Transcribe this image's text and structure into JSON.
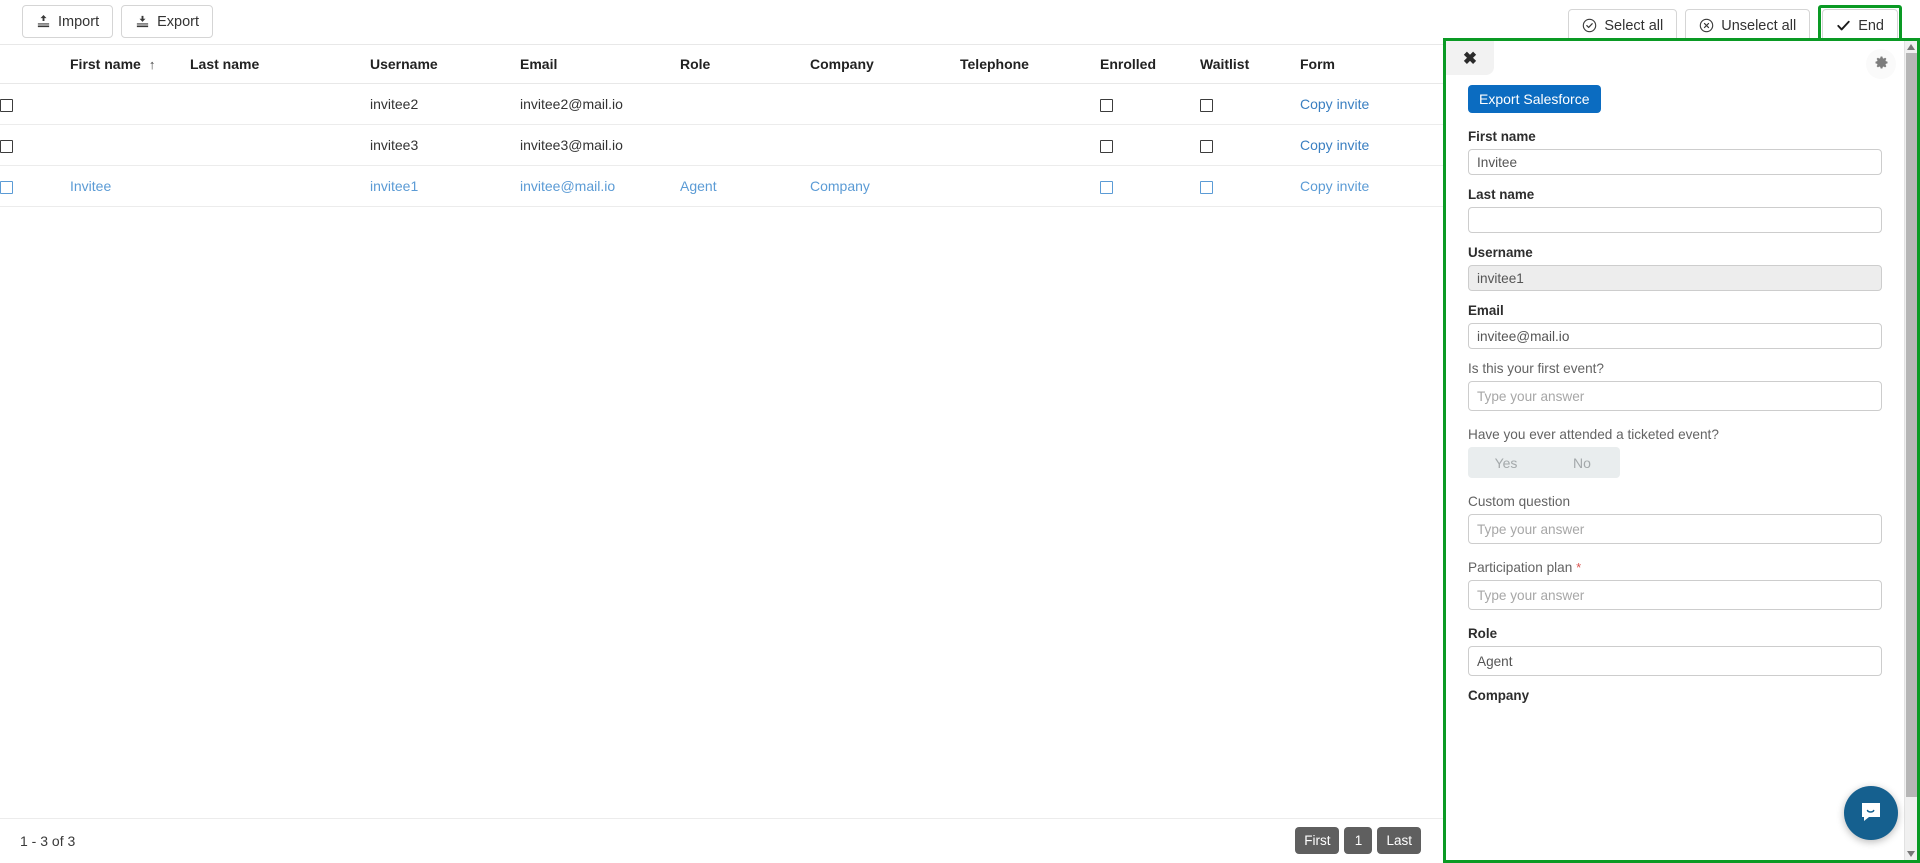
{
  "toolbar": {
    "import_label": "Import",
    "export_label": "Export",
    "select_all_label": "Select all",
    "unselect_all_label": "Unselect all",
    "end_label": "End"
  },
  "table": {
    "columns": [
      "",
      "First name",
      "Last name",
      "Username",
      "Email",
      "Role",
      "Company",
      "Telephone",
      "Enrolled",
      "Waitlist",
      "Form"
    ],
    "sort_column": "First name",
    "sort_direction": "↑",
    "rows": [
      {
        "first_name": "",
        "last_name": "",
        "username": "invitee2",
        "email": "invitee2@mail.io",
        "role": "",
        "company": "",
        "telephone": "",
        "form_link": "Copy invite",
        "selected": false
      },
      {
        "first_name": "",
        "last_name": "",
        "username": "invitee3",
        "email": "invitee3@mail.io",
        "role": "",
        "company": "",
        "telephone": "",
        "form_link": "Copy invite",
        "selected": false
      },
      {
        "first_name": "Invitee",
        "last_name": "",
        "username": "invitee1",
        "email": "invitee@mail.io",
        "role": "Agent",
        "company": "Company",
        "telephone": "",
        "form_link": "Copy invite",
        "selected": true
      }
    ]
  },
  "footer": {
    "count_label": "1 - 3 of 3",
    "pager": {
      "first_label": "First",
      "page_label": "1",
      "last_label": "Last"
    }
  },
  "panel": {
    "close_label": "✖",
    "export_salesforce_label": "Export Salesforce",
    "fields": [
      {
        "label": "First name",
        "value": "Invitee",
        "placeholder": "",
        "type": "text",
        "bold": true,
        "disabled": false,
        "required": false
      },
      {
        "label": "Last name",
        "value": "",
        "placeholder": "",
        "type": "text",
        "bold": true,
        "disabled": false,
        "required": false
      },
      {
        "label": "Username",
        "value": "invitee1",
        "placeholder": "",
        "type": "text",
        "bold": true,
        "disabled": true,
        "required": false
      },
      {
        "label": "Email",
        "value": "invitee@mail.io",
        "placeholder": "",
        "type": "text",
        "bold": true,
        "disabled": false,
        "required": false
      },
      {
        "label": "Is this your first event?",
        "value": "",
        "placeholder": "Type your answer",
        "type": "text",
        "bold": false,
        "disabled": false,
        "required": false
      },
      {
        "label": "Have you ever attended a ticketed event?",
        "value": "",
        "placeholder": "",
        "type": "yesno",
        "bold": false,
        "disabled": false,
        "required": false
      },
      {
        "label": "Custom question",
        "value": "",
        "placeholder": "Type your answer",
        "type": "text",
        "bold": false,
        "disabled": false,
        "required": false
      },
      {
        "label": "Participation plan",
        "value": "",
        "placeholder": "Type your answer",
        "type": "text",
        "bold": false,
        "disabled": false,
        "required": true
      },
      {
        "label": "Role",
        "value": "Agent",
        "placeholder": "",
        "type": "text",
        "bold": true,
        "disabled": false,
        "required": false
      },
      {
        "label": "Company",
        "value": "",
        "placeholder": "",
        "type": "cutoff",
        "bold": true,
        "disabled": false,
        "required": false
      }
    ],
    "yes_label": "Yes",
    "no_label": "No",
    "required_marker": "*"
  },
  "colors": {
    "accent_blue": "#0b6cc1",
    "link_blue": "#3a7fc1",
    "highlight_green": "#0a9a24",
    "selected_row_blue": "#5b9bd5",
    "chat_blue": "#15608f"
  }
}
